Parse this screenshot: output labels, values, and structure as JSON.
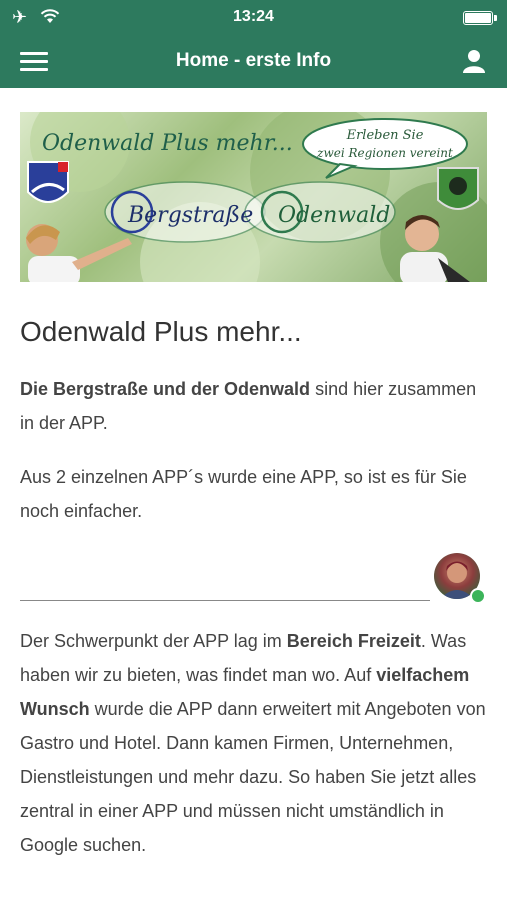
{
  "status": {
    "time": "13:24"
  },
  "nav": {
    "title": "Home - erste Info"
  },
  "banner": {
    "title": "Odenwald Plus mehr...",
    "speech_line1": "Erleben Sie",
    "speech_line2": "zwei Regionen vereint",
    "left_word": "Bergstraße",
    "right_word": "Odenwald"
  },
  "content": {
    "heading": "Odenwald Plus mehr...",
    "p1_bold": "Die Bergstraße und der Odenwald",
    "p1_rest": " sind hier zusammen in der APP.",
    "p2": "Aus 2 einzelnen APP´s wurde eine APP, so ist es für Sie noch einfacher.",
    "p3_a": "Der Schwerpunkt der APP lag im ",
    "p3_b": "Bereich Freizeit",
    "p3_c": ". Was haben wir zu bieten, was findet man wo. Auf ",
    "p3_d": "vielfachem Wunsch",
    "p3_e": " wurde die APP dann erweitert mit Angeboten von Gastro und Hotel. Dann kamen Firmen, Unternehmen, Dienstleistungen und mehr dazu. So haben Sie jetzt alles zentral in einer APP und müssen nicht umständlich in Google suchen."
  },
  "colors": {
    "brand": "#2d7a5e",
    "online": "#3cb45a"
  },
  "icons": [
    "airplane-icon",
    "wifi-icon",
    "battery-icon",
    "menu-icon",
    "user-icon"
  ]
}
